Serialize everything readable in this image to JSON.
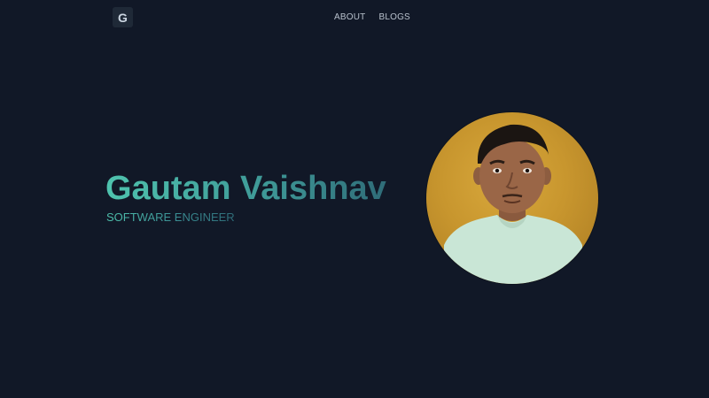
{
  "header": {
    "logo_letter": "G",
    "nav": [
      {
        "label": "ABOUT"
      },
      {
        "label": "BLOGS"
      }
    ]
  },
  "hero": {
    "name": "Gautam Vaishnav",
    "role": "SOFTWARE ENGINEER"
  },
  "colors": {
    "background": "#111827",
    "accent_start": "#4fc3ae",
    "accent_end": "#2f6c78"
  }
}
